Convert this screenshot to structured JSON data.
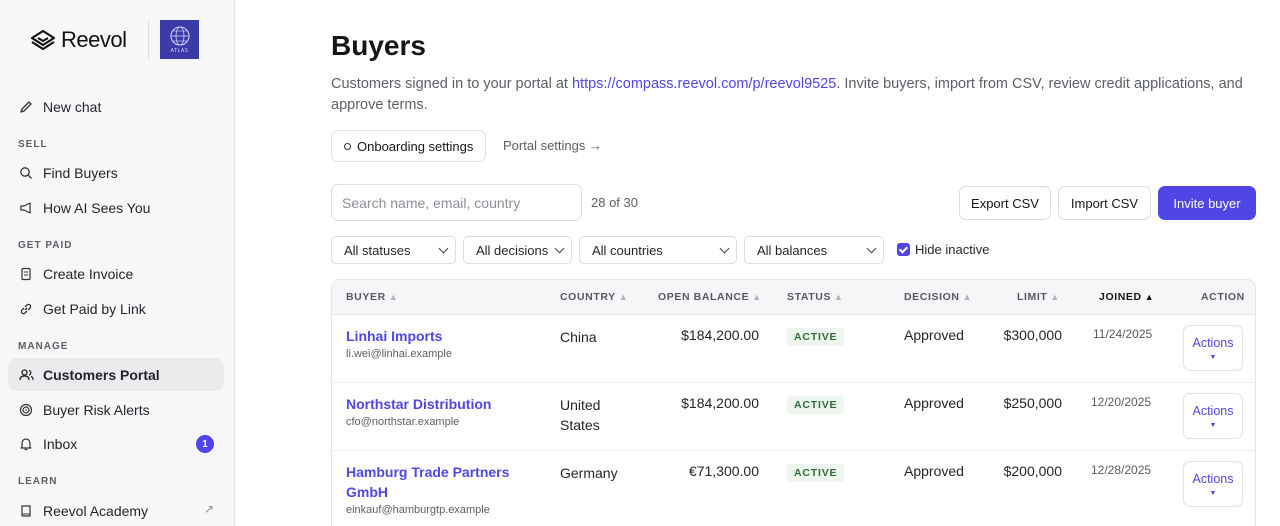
{
  "brand": {
    "name": "Reevol",
    "partner_text": "ATLAS"
  },
  "sidebar": {
    "new_chat": "New chat",
    "sections": {
      "sell": "SELL",
      "get_paid": "GET PAID",
      "manage": "MANAGE",
      "learn": "LEARN"
    },
    "items": {
      "find_buyers": "Find Buyers",
      "ai_sees": "How AI Sees You",
      "create_invoice": "Create Invoice",
      "paid_by_link": "Get Paid by Link",
      "customers_portal": "Customers Portal",
      "risk_alerts": "Buyer Risk Alerts",
      "inbox": "Inbox",
      "academy": "Reevol Academy"
    },
    "inbox_badge": "1",
    "active_item": "Customers Portal"
  },
  "page": {
    "title": "Buyers",
    "subtitle_pre": "Customers signed in to your portal at ",
    "subtitle_link": "https://compass.reevol.com/p/reevol9525",
    "subtitle_post": ". Invite buyers, import from CSV, review credit applications, and approve terms.",
    "onboarding_btn": "Onboarding settings",
    "portal_link": "Portal settings →"
  },
  "toolbar": {
    "search_placeholder": "Search name, email, country",
    "count": "28 of 30",
    "export": "Export CSV",
    "import": "Import CSV",
    "invite": "Invite buyer"
  },
  "filters": {
    "status": "All statuses",
    "decision": "All decisions",
    "country": "All countries",
    "balance": "All balances",
    "hide_inactive": "Hide inactive",
    "hide_inactive_checked": true
  },
  "table": {
    "headers": {
      "buyer": "BUYER",
      "country": "COUNTRY",
      "balance": "OPEN BALANCE",
      "status": "STATUS",
      "decision": "DECISION",
      "limit": "LIMIT",
      "joined": "JOINED",
      "action": "ACTION"
    },
    "sort_inactive": "▲",
    "sort_active": "▲",
    "rows": [
      {
        "name": "Linhai Imports",
        "email": "li.wei@linhai.example",
        "country": "China",
        "balance": "$184,200.00",
        "status": "ACTIVE",
        "decision": "Approved",
        "limit": "$300,000",
        "joined": "11/24/2025",
        "action": "Actions"
      },
      {
        "name": "Northstar Distribution",
        "email": "cfo@northstar.example",
        "country": "United States",
        "balance": "$184,200.00",
        "status": "ACTIVE",
        "decision": "Approved",
        "limit": "$250,000",
        "joined": "12/20/2025",
        "action": "Actions"
      },
      {
        "name": "Hamburg Trade Partners GmbH",
        "email": "einkauf@hamburgtp.example",
        "country": "Germany",
        "balance": "€71,300.00",
        "status": "ACTIVE",
        "decision": "Approved",
        "limit": "$200,000",
        "joined": "12/28/2025",
        "action": "Actions"
      }
    ],
    "action_caret": "▼"
  },
  "colors": {
    "accent": "#4f46e5",
    "status_bg": "#eef5ee",
    "status_fg": "#2f6b3a"
  }
}
